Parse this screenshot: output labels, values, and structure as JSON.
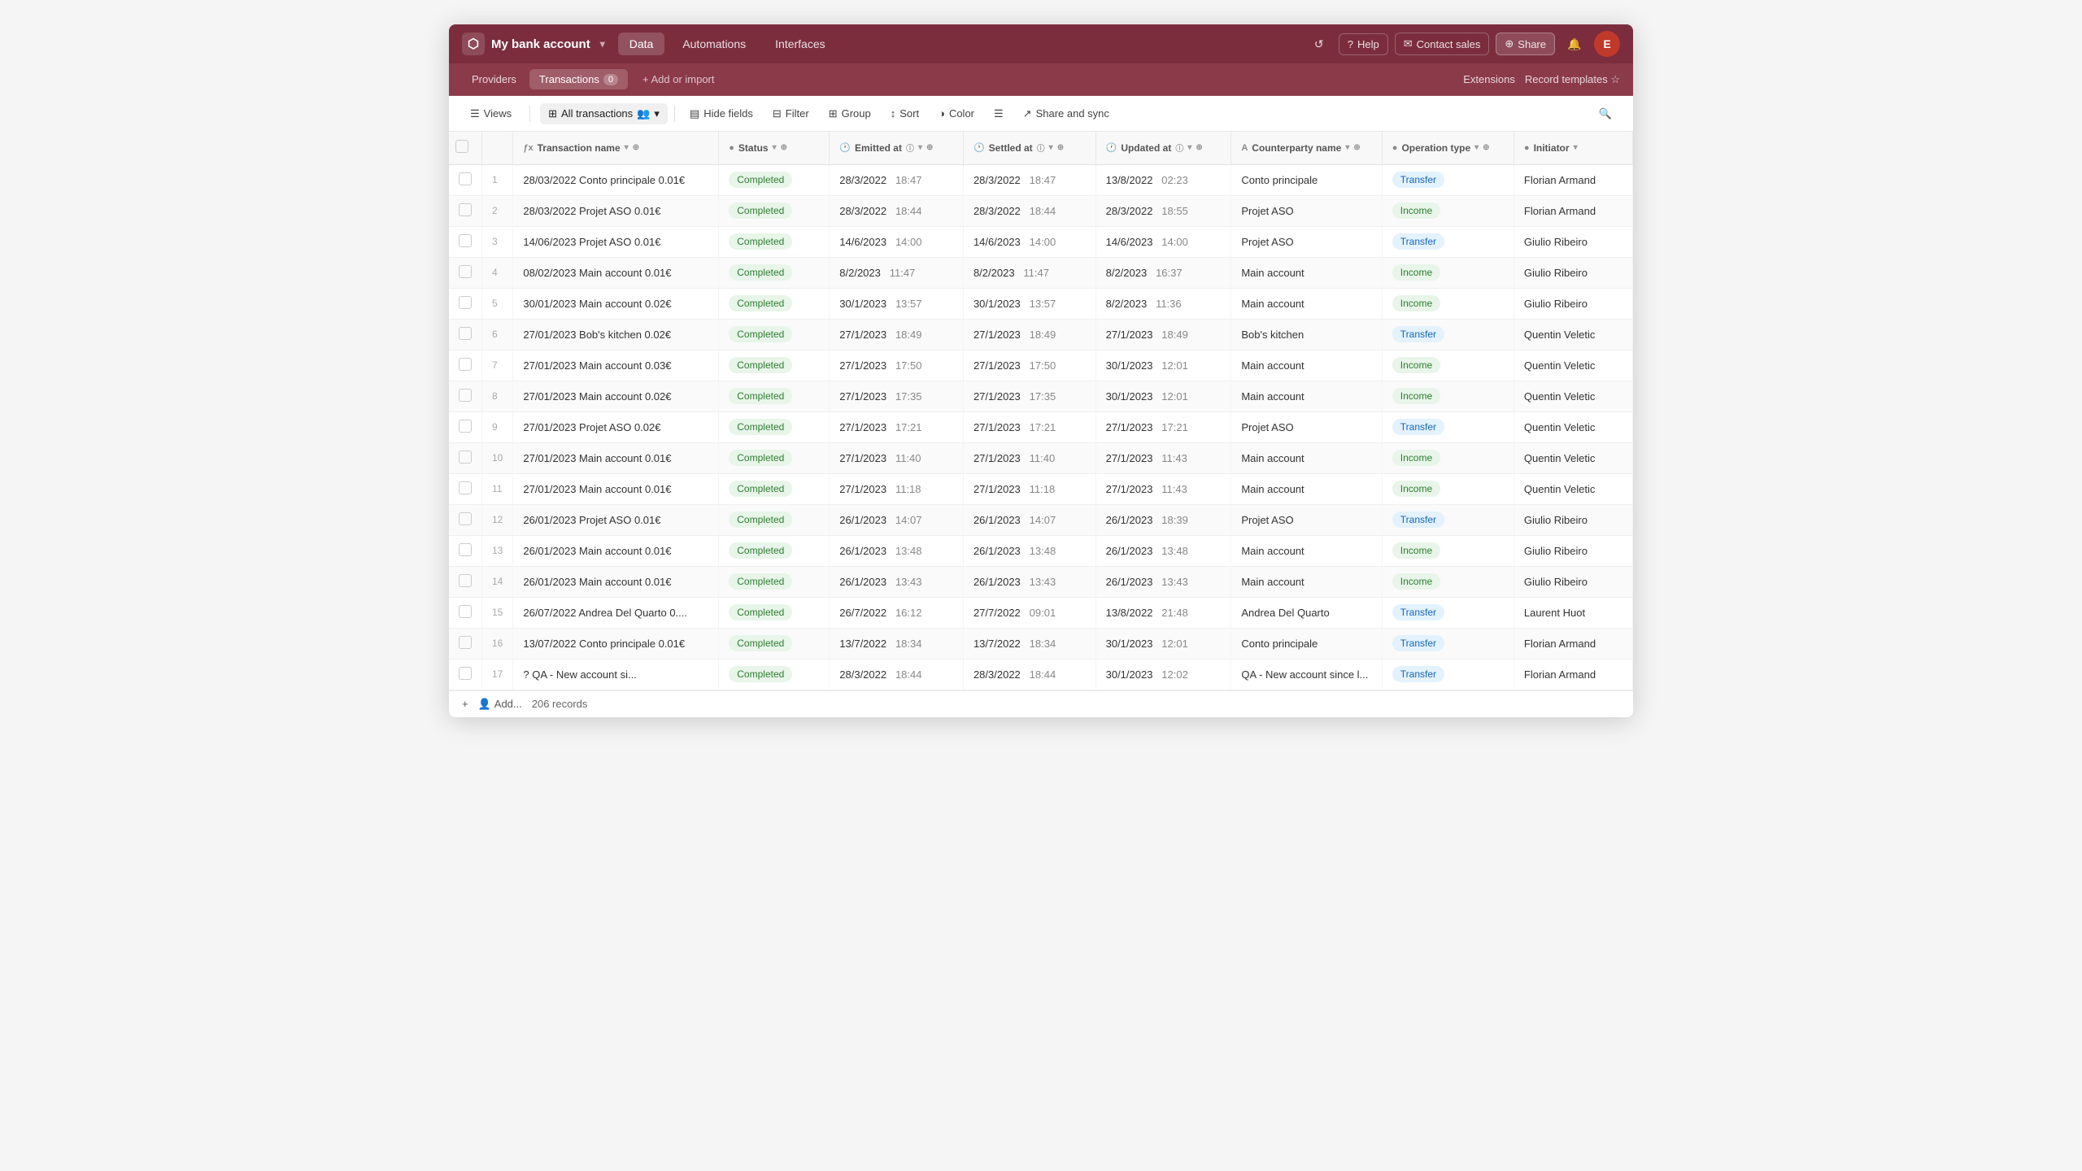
{
  "app": {
    "title": "My bank account",
    "logo_char": "⬡"
  },
  "nav": {
    "tabs": [
      {
        "id": "data",
        "label": "Data",
        "active": true
      },
      {
        "id": "automations",
        "label": "Automations",
        "active": false
      },
      {
        "id": "interfaces",
        "label": "Interfaces",
        "active": false
      }
    ],
    "right_buttons": [
      {
        "id": "history",
        "icon": "↺",
        "label": ""
      },
      {
        "id": "help",
        "icon": "?",
        "label": "Help"
      },
      {
        "id": "contact",
        "icon": "✉",
        "label": "Contact sales"
      },
      {
        "id": "share",
        "icon": "⊕",
        "label": "Share"
      }
    ],
    "avatar_letter": "E"
  },
  "sub_nav": {
    "tabs": [
      {
        "id": "providers",
        "label": "Providers",
        "active": false,
        "badge": ""
      },
      {
        "id": "transactions",
        "label": "Transactions",
        "active": true,
        "badge": "0"
      }
    ],
    "add_label": "+ Add or import",
    "right": [
      {
        "id": "extensions",
        "label": "Extensions"
      },
      {
        "id": "record-templates",
        "label": "Record templates ☆"
      }
    ]
  },
  "toolbar": {
    "views_label": "Views",
    "active_view": "All transactions",
    "buttons": [
      {
        "id": "hide-fields",
        "icon": "▤",
        "label": "Hide fields"
      },
      {
        "id": "filter",
        "icon": "⊟",
        "label": "Filter"
      },
      {
        "id": "group",
        "icon": "⊞",
        "label": "Group"
      },
      {
        "id": "sort",
        "icon": "↕",
        "label": "Sort"
      },
      {
        "id": "color",
        "icon": "◑",
        "label": "Color"
      },
      {
        "id": "row-height",
        "icon": "☰",
        "label": ""
      },
      {
        "id": "share-sync",
        "icon": "↗",
        "label": "Share and sync"
      }
    ],
    "search_icon": "🔍"
  },
  "table": {
    "columns": [
      {
        "id": "checkbox",
        "label": "",
        "type": ""
      },
      {
        "id": "row-num",
        "label": "",
        "type": ""
      },
      {
        "id": "transaction-name",
        "label": "Transaction name",
        "type": "fx",
        "sortable": true
      },
      {
        "id": "status",
        "label": "Status",
        "type": "circle",
        "sortable": true
      },
      {
        "id": "emitted-at",
        "label": "Emitted at",
        "type": "clock",
        "sortable": true
      },
      {
        "id": "settled-at",
        "label": "Settled at",
        "type": "clock",
        "sortable": true
      },
      {
        "id": "updated-at",
        "label": "Updated at",
        "type": "clock",
        "sortable": true
      },
      {
        "id": "counterparty-name",
        "label": "Counterparty name",
        "type": "A",
        "sortable": true
      },
      {
        "id": "operation-type",
        "label": "Operation type",
        "type": "circle",
        "sortable": true
      },
      {
        "id": "initiator",
        "label": "Initiator",
        "type": "circle",
        "sortable": true
      }
    ],
    "rows": [
      {
        "num": 1,
        "name": "28/03/2022 Conto principale 0.01€",
        "status": "Completed",
        "emitted_date": "28/3/2022",
        "emitted_time": "18:47",
        "settled_date": "28/3/2022",
        "settled_time": "18:47",
        "updated_date": "13/8/2022",
        "updated_time": "02:23",
        "counterparty": "Conto principale",
        "op_type": "Transfer",
        "op_class": "op-transfer",
        "initiator": "Florian Armand"
      },
      {
        "num": 2,
        "name": "28/03/2022 Projet ASO 0.01€",
        "status": "Completed",
        "emitted_date": "28/3/2022",
        "emitted_time": "18:44",
        "settled_date": "28/3/2022",
        "settled_time": "18:44",
        "updated_date": "28/3/2022",
        "updated_time": "18:55",
        "counterparty": "Projet ASO",
        "op_type": "Income",
        "op_class": "op-income",
        "initiator": "Florian Armand"
      },
      {
        "num": 3,
        "name": "14/06/2023 Projet ASO 0.01€",
        "status": "Completed",
        "emitted_date": "14/6/2023",
        "emitted_time": "14:00",
        "settled_date": "14/6/2023",
        "settled_time": "14:00",
        "updated_date": "14/6/2023",
        "updated_time": "14:00",
        "counterparty": "Projet ASO",
        "op_type": "Transfer",
        "op_class": "op-transfer",
        "initiator": "Giulio Ribeiro"
      },
      {
        "num": 4,
        "name": "08/02/2023 Main account 0.01€",
        "status": "Completed",
        "emitted_date": "8/2/2023",
        "emitted_time": "11:47",
        "settled_date": "8/2/2023",
        "settled_time": "11:47",
        "updated_date": "8/2/2023",
        "updated_time": "16:37",
        "counterparty": "Main account",
        "op_type": "Income",
        "op_class": "op-income",
        "initiator": "Giulio Ribeiro"
      },
      {
        "num": 5,
        "name": "30/01/2023 Main account 0.02€",
        "status": "Completed",
        "emitted_date": "30/1/2023",
        "emitted_time": "13:57",
        "settled_date": "30/1/2023",
        "settled_time": "13:57",
        "updated_date": "8/2/2023",
        "updated_time": "11:36",
        "counterparty": "Main account",
        "op_type": "Income",
        "op_class": "op-income",
        "initiator": "Giulio Ribeiro"
      },
      {
        "num": 6,
        "name": "27/01/2023 Bob's kitchen 0.02€",
        "status": "Completed",
        "emitted_date": "27/1/2023",
        "emitted_time": "18:49",
        "settled_date": "27/1/2023",
        "settled_time": "18:49",
        "updated_date": "27/1/2023",
        "updated_time": "18:49",
        "counterparty": "Bob's kitchen",
        "op_type": "Transfer",
        "op_class": "op-transfer",
        "initiator": "Quentin Veletic"
      },
      {
        "num": 7,
        "name": "27/01/2023 Main account 0.03€",
        "status": "Completed",
        "emitted_date": "27/1/2023",
        "emitted_time": "17:50",
        "settled_date": "27/1/2023",
        "settled_time": "17:50",
        "updated_date": "30/1/2023",
        "updated_time": "12:01",
        "counterparty": "Main account",
        "op_type": "Income",
        "op_class": "op-income",
        "initiator": "Quentin Veletic"
      },
      {
        "num": 8,
        "name": "27/01/2023 Main account 0.02€",
        "status": "Completed",
        "emitted_date": "27/1/2023",
        "emitted_time": "17:35",
        "settled_date": "27/1/2023",
        "settled_time": "17:35",
        "updated_date": "30/1/2023",
        "updated_time": "12:01",
        "counterparty": "Main account",
        "op_type": "Income",
        "op_class": "op-income",
        "initiator": "Quentin Veletic"
      },
      {
        "num": 9,
        "name": "27/01/2023 Projet ASO 0.02€",
        "status": "Completed",
        "emitted_date": "27/1/2023",
        "emitted_time": "17:21",
        "settled_date": "27/1/2023",
        "settled_time": "17:21",
        "updated_date": "27/1/2023",
        "updated_time": "17:21",
        "counterparty": "Projet ASO",
        "op_type": "Transfer",
        "op_class": "op-transfer",
        "initiator": "Quentin Veletic"
      },
      {
        "num": 10,
        "name": "27/01/2023 Main account 0.01€",
        "status": "Completed",
        "emitted_date": "27/1/2023",
        "emitted_time": "11:40",
        "settled_date": "27/1/2023",
        "settled_time": "11:40",
        "updated_date": "27/1/2023",
        "updated_time": "11:43",
        "counterparty": "Main account",
        "op_type": "Income",
        "op_class": "op-income",
        "initiator": "Quentin Veletic"
      },
      {
        "num": 11,
        "name": "27/01/2023 Main account 0.01€",
        "status": "Completed",
        "emitted_date": "27/1/2023",
        "emitted_time": "11:18",
        "settled_date": "27/1/2023",
        "settled_time": "11:18",
        "updated_date": "27/1/2023",
        "updated_time": "11:43",
        "counterparty": "Main account",
        "op_type": "Income",
        "op_class": "op-income",
        "initiator": "Quentin Veletic"
      },
      {
        "num": 12,
        "name": "26/01/2023 Projet ASO 0.01€",
        "status": "Completed",
        "emitted_date": "26/1/2023",
        "emitted_time": "14:07",
        "settled_date": "26/1/2023",
        "settled_time": "14:07",
        "updated_date": "26/1/2023",
        "updated_time": "18:39",
        "counterparty": "Projet ASO",
        "op_type": "Transfer",
        "op_class": "op-transfer",
        "initiator": "Giulio Ribeiro"
      },
      {
        "num": 13,
        "name": "26/01/2023 Main account 0.01€",
        "status": "Completed",
        "emitted_date": "26/1/2023",
        "emitted_time": "13:48",
        "settled_date": "26/1/2023",
        "settled_time": "13:48",
        "updated_date": "26/1/2023",
        "updated_time": "13:48",
        "counterparty": "Main account",
        "op_type": "Income",
        "op_class": "op-income",
        "initiator": "Giulio Ribeiro"
      },
      {
        "num": 14,
        "name": "26/01/2023 Main account 0.01€",
        "status": "Completed",
        "emitted_date": "26/1/2023",
        "emitted_time": "13:43",
        "settled_date": "26/1/2023",
        "settled_time": "13:43",
        "updated_date": "26/1/2023",
        "updated_time": "13:43",
        "counterparty": "Main account",
        "op_type": "Income",
        "op_class": "op-income",
        "initiator": "Giulio Ribeiro"
      },
      {
        "num": 15,
        "name": "26/07/2022 Andrea Del Quarto 0....",
        "status": "Completed",
        "emitted_date": "26/7/2022",
        "emitted_time": "16:12",
        "settled_date": "27/7/2022",
        "settled_time": "09:01",
        "updated_date": "13/8/2022",
        "updated_time": "21:48",
        "counterparty": "Andrea Del Quarto",
        "op_type": "Transfer",
        "op_class": "op-transfer",
        "initiator": "Laurent Huot"
      },
      {
        "num": 16,
        "name": "13/07/2022 Conto principale 0.01€",
        "status": "Completed",
        "emitted_date": "13/7/2022",
        "emitted_time": "18:34",
        "settled_date": "13/7/2022",
        "settled_time": "18:34",
        "updated_date": "30/1/2023",
        "updated_time": "12:01",
        "counterparty": "Conto principale",
        "op_type": "Transfer",
        "op_class": "op-transfer",
        "initiator": "Florian Armand"
      },
      {
        "num": 17,
        "name": "? QA - New account si...",
        "status": "Completed",
        "emitted_date": "28/3/2022",
        "emitted_time": "18:44",
        "settled_date": "28/3/2022",
        "settled_time": "18:44",
        "updated_date": "30/1/2023",
        "updated_time": "12:02",
        "counterparty": "QA - New account since l...",
        "op_type": "Transfer",
        "op_class": "op-transfer",
        "initiator": "Florian Armand"
      }
    ],
    "total_records": "206 records"
  }
}
